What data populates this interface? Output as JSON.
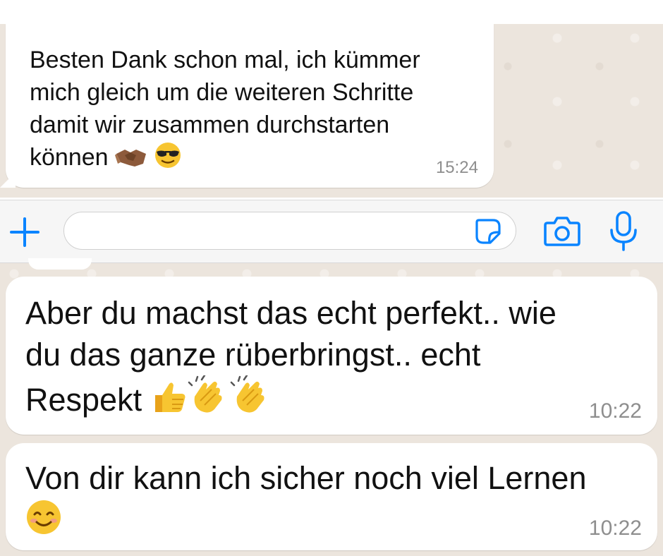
{
  "messages": [
    {
      "text": "Besten Dank schon mal, ich kümmer\nmich gleich um die weiteren Schritte\ndamit wir zusammen durchstarten\nkönnen",
      "emojis": [
        "handshake-emoji",
        "sunglasses-face-emoji"
      ],
      "time": "15:24"
    },
    {
      "text": "Aber du machst das echt perfekt.. wie\ndu das ganze rüberbringst.. echt\nRespekt",
      "emojis": [
        "thumbs-up-emoji",
        "clapping-hands-emoji",
        "clapping-hands-emoji"
      ],
      "time": "10:22"
    },
    {
      "text": "Von dir kann ich sicher noch viel Lernen",
      "emojis": [
        "smiling-face-emoji"
      ],
      "time": "10:22"
    }
  ],
  "input_bar": {
    "placeholder": "",
    "icons": [
      "plus-icon",
      "sticker-icon",
      "camera-icon",
      "microphone-icon"
    ],
    "accent_color": "#0a84ff"
  },
  "colors": {
    "wallpaper": "#ece5dd",
    "bubble": "#ffffff",
    "timestamp": "#8e8e8e"
  }
}
